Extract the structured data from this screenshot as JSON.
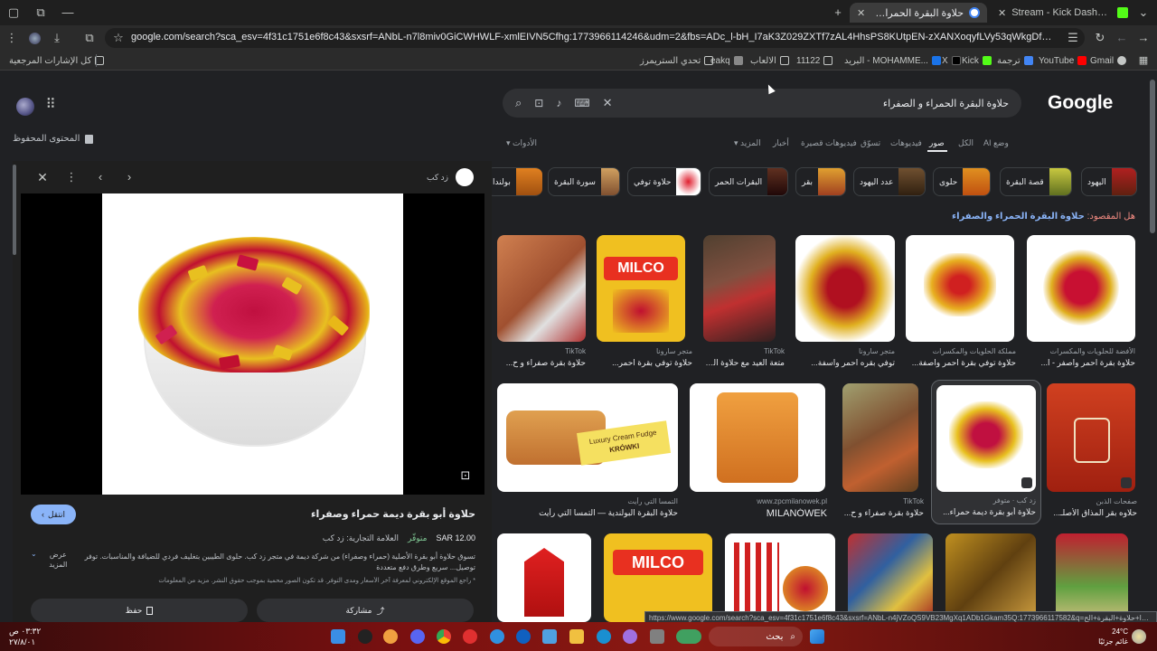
{
  "browser": {
    "tabs": [
      {
        "title": "Stream - Kick Dashboard",
        "favicon_color": "#53fc18",
        "active": false
      },
      {
        "title": "حلاوة البقرة الحمراء و الصفراء - بحث",
        "favicon_color": "#ffffff",
        "active": true
      }
    ],
    "address": "google.com/search?sca_esv=4f31c1751e6f8c43&sxsrf=ANbL-n7l8miv0GiCWHWLF-xmlEIVN5Cfhg:1773966114246&udm=2&fbs=ADc_l-bH_I7aK3Z029ZXTf7zAL4HhsPS8KUtpEN-zXANXoqyfLVy53qWkgDfUzvgURm1ots4PiKBTQJtMj_TQ1eaAD4epVcPE_..."
  },
  "bookmarks": {
    "all_label": "كل الإشارات المرجعية",
    "items": [
      "Gmail",
      "YouTube",
      "ترجمة",
      "Kick",
      "X",
      "البريد - MOHAMME...",
      "11122",
      "الالعاب",
      "eakq",
      "تحدي الستريمرز"
    ]
  },
  "search": {
    "query": "حلاوة البقرة الحمراء و الصفراء",
    "logo": "Google",
    "saved_label": "المحتوى المحفوظ",
    "filters": [
      {
        "label": "وضع AI",
        "selected": false
      },
      {
        "label": "الكل",
        "selected": false
      },
      {
        "label": "صور",
        "selected": true
      },
      {
        "label": "فيديوهات",
        "selected": false
      },
      {
        "label": "تسوّق",
        "selected": false
      },
      {
        "label": "فيديوهات قصيرة",
        "selected": false
      },
      {
        "label": "أخبار",
        "selected": false
      },
      {
        "label": "المزيد",
        "selected": false
      }
    ],
    "tools_label": "الأدوات",
    "chips": [
      "اليهود",
      "قصة البقرة",
      "حلوى",
      "عدد اليهود",
      "بقر",
      "البقرات الحمر",
      "حلاوة توفي",
      "سورة البقرة",
      "بولندا"
    ],
    "did_you_mean_prefix": "هل المقصود:",
    "did_you_mean": "حلاوة البقرة الحمراء والصفراء"
  },
  "results": [
    {
      "source": "الأفضة للحلويات والمكسرات",
      "title": "حلاوة بقرة احمر واصفر - ا...",
      "color": "#c81032"
    },
    {
      "source": "مملكة الحلويات والمكسرات",
      "title": "حلاوة توفي بقرة احمر واصفة...",
      "color": "#e0b020"
    },
    {
      "source": "متجر سارونا",
      "title": "توفي بقره احمر واسفة...",
      "color": "#b01020"
    },
    {
      "source": "TikTok",
      "title": "متعة العيد مع حلاوة البق...",
      "color": "#704030"
    },
    {
      "source": "متجر سارونا",
      "title": "حلاوة توفي بقرة احمر...",
      "color": "#e8c020"
    },
    {
      "source": "TikTok",
      "title": "حلاوة بقرة صفراء و ح...",
      "color": "#c08050"
    },
    {
      "source": "صفحات الذبن",
      "title": "حلاوه بقر المذاق الأصلـ...",
      "color": "#c03018"
    },
    {
      "source": "زد كب · متوفر",
      "title": "حلاوة أبو بقرة ديمة حمراء...",
      "color": "#ffffff"
    },
    {
      "source": "TikTok",
      "title": "حلاوة بقرة صفراء و ح...",
      "color": "#8a6040"
    },
    {
      "source": "www.zpcmilanowek.pl",
      "title": "MILANÓWEK",
      "color": "#e89020"
    },
    {
      "source": "التمسا التي رأيت",
      "title": "حلاوة البقرة البولندية — التمسا التي رأيت",
      "color": "#d09040"
    }
  ],
  "detail": {
    "site": "زد كب",
    "title": "حلاوة أبو بقرة ديمة حمراء وصفراء",
    "visit_label": "انتقل",
    "price": "SAR 12.00",
    "stock": "متوفّر",
    "brand": "العلامة التجارية: زد كب",
    "description": "تسوق حلاوة أبو بقرة الأصلية (حمراء وصفراء) من شركة ديمة في متجر زد كب. حلوى الطيبين بتغليف فردي للضيافة والمناسبات. توفر توصيل... سريع وطرق دفع متعددة",
    "more_label": "عرض المزيد",
    "note": "* راجع الموقع الإلكتروني لمعرفة آخر الأسعار ومدى التوفر. قد تكون الصور محمية بموجب حقوق النشر. مزيد من المعلومات",
    "save_label": "حفظ",
    "share_label": "مشاركة"
  },
  "status_url": "https://www.google.com/search?sca_esv=4f31c1751e6f8c43&sxsrf=ANbL-n4jVZoQS9VB23MgXq1ADb1Gkam35Q:1773966117582&q=بولندا+حلاوة+البقرة+الح...",
  "taskbar": {
    "time": "٠٣:٣٢ ص",
    "date": "٢٧/٨/٠١",
    "search_label": "بحث",
    "weather_temp": "24°C",
    "weather_text": "غائم جزئيًا"
  }
}
